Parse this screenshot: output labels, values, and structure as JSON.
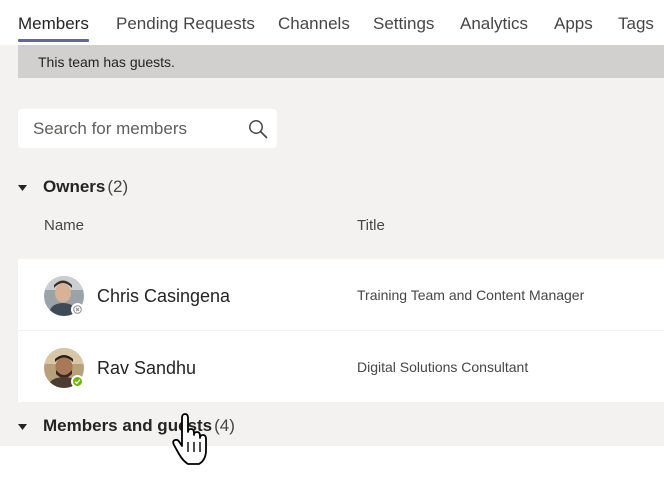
{
  "tabs": [
    {
      "label": "Members",
      "active": true
    },
    {
      "label": "Pending Requests",
      "active": false
    },
    {
      "label": "Channels",
      "active": false
    },
    {
      "label": "Settings",
      "active": false
    },
    {
      "label": "Analytics",
      "active": false
    },
    {
      "label": "Apps",
      "active": false
    },
    {
      "label": "Tags",
      "active": false
    }
  ],
  "banner": {
    "text": "This team has guests."
  },
  "search": {
    "placeholder": "Search for members",
    "value": ""
  },
  "owners": {
    "label": "Owners",
    "count": "(2)"
  },
  "columns": {
    "name": "Name",
    "title": "Title"
  },
  "members": [
    {
      "name": "Chris Casingena",
      "title": "Training Team and Content Manager",
      "presence": "offline"
    },
    {
      "name": "Rav Sandhu",
      "title": "Digital Solutions Consultant",
      "presence": "available"
    }
  ],
  "members_and_guests": {
    "label": "Members and guests",
    "count": "(4)"
  },
  "colors": {
    "accent": "#6264a7",
    "available": "#6bb700",
    "offline": "#8a8886",
    "banner": "#d2d0ce"
  },
  "icons": {
    "search": "search-icon",
    "caret": "caret-down-icon",
    "cursor": "hand-pointer-icon"
  }
}
